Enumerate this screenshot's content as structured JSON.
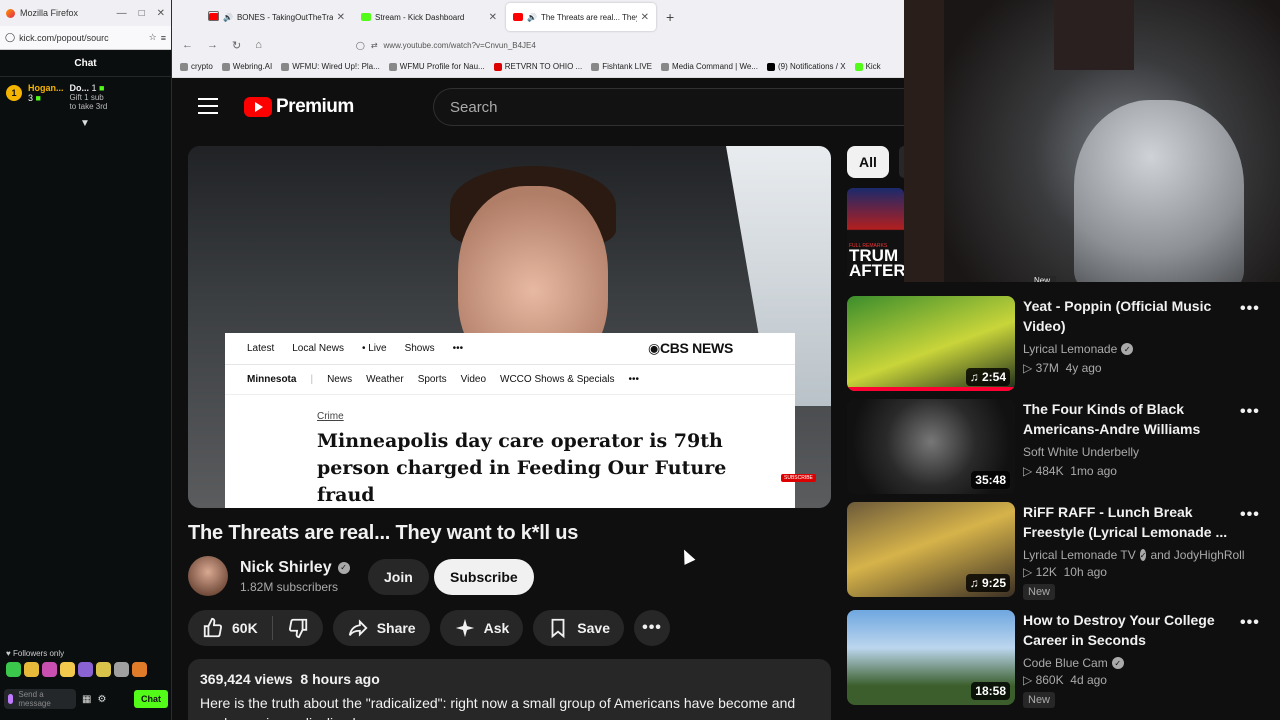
{
  "kick": {
    "window_title": "Mozilla Firefox",
    "url": "kick.com/popout/sourc",
    "chat_title": "Chat",
    "pinned": {
      "rank": "1",
      "user1": "Hogan...",
      "user1_count": "3",
      "user2": "Do...",
      "user2_count": "1",
      "gift_line1": "Gift 1 sub",
      "gift_line2": "to take 3rd"
    },
    "followers_only": "Followers only",
    "message_placeholder": "Send a message",
    "chat_button": "Chat",
    "colors": {
      "accent": "#53fc18"
    }
  },
  "browser": {
    "tabs": [
      {
        "label": "BONES - TakingOutTheTrash",
        "favicon_color": "#ff0000",
        "active": false
      },
      {
        "label": "Stream - Kick Dashboard",
        "favicon_color": "#53fc18",
        "active": false
      },
      {
        "label": "The Threats are real... They",
        "favicon_color": "#ff0000",
        "active": true
      }
    ],
    "new_tab": "+",
    "address": "www.youtube.com/watch?v=Cnvun_B4JE4",
    "bookmarks": [
      "crypto",
      "Webring.AI",
      "WFMU: Wired Up!: Pla...",
      "WFMU Profile for Nau...",
      "RETVRN TO OHIO ...",
      "Fishtank LIVE",
      "Media Command | We...",
      "(9) Notifications / X",
      "Kick"
    ]
  },
  "youtube": {
    "brand": "Premium",
    "search_placeholder": "Search",
    "video": {
      "title": "The Threats are real... They want to k*ll us",
      "channel": "Nick Shirley",
      "subscribers": "1.82M subscribers",
      "join_label": "Join",
      "subscribe_label": "Subscribe",
      "likes": "60K",
      "share_label": "Share",
      "ask_label": "Ask",
      "save_label": "Save",
      "views": "369,424 views",
      "age": "8 hours ago",
      "description": "Here is the truth about the \"radicalized\": right now a small group of Americans have become and are becoming radicalized"
    },
    "overlay_article": {
      "nav1": [
        "Latest",
        "Local News",
        "• Live",
        "Shows",
        "•••"
      ],
      "brand": "CBS NEWS",
      "nav2_selected": "Minnesota",
      "nav2": [
        "News",
        "Weather",
        "Sports",
        "Video",
        "WCCO Shows & Specials",
        "•••"
      ],
      "category": "Crime",
      "headline": "Minneapolis day care operator is 79th person charged in Feeding Our Future fraud",
      "subscribe_badge": "SUBSCRIBE"
    },
    "chips": [
      "All"
    ],
    "partial_thumb_text": "TRUM\nAFTER",
    "partial_thumb_small": "FULL REMARKS",
    "recommendations": [
      {
        "title": "Yeat - Poppin (Official Music Video)",
        "channel": "Lyrical Lemonade",
        "verified": true,
        "views": "37M",
        "age": "4y ago",
        "duration": "2:54",
        "music": true,
        "watched": true,
        "new": false,
        "thumb_color": "#3b8d2c"
      },
      {
        "title": "The Four Kinds of Black Americans-Andre Williams",
        "channel": "Soft White Underbelly",
        "verified": false,
        "views": "484K",
        "age": "1mo ago",
        "duration": "35:48",
        "music": false,
        "watched": false,
        "new": false,
        "thumb_color": "#2b2b2b"
      },
      {
        "title": "RiFF RAFF - Lunch Break Freestyle (Lyrical Lemonade ...",
        "channel": "Lyrical Lemonade TV",
        "channel_extra": "and JodyHighRoll",
        "verified": true,
        "views": "12K",
        "age": "10h ago",
        "duration": "9:25",
        "music": true,
        "watched": false,
        "new": true,
        "thumb_color": "#6c5a3a"
      },
      {
        "title": "How to Destroy Your College Career in Seconds",
        "channel": "Code Blue Cam",
        "verified": true,
        "views": "860K",
        "age": "4d ago",
        "duration": "18:58",
        "music": false,
        "watched": false,
        "new": true,
        "thumb_color": "#4d7fb5"
      }
    ],
    "new_label": "New",
    "webcam_new_label": "New"
  }
}
